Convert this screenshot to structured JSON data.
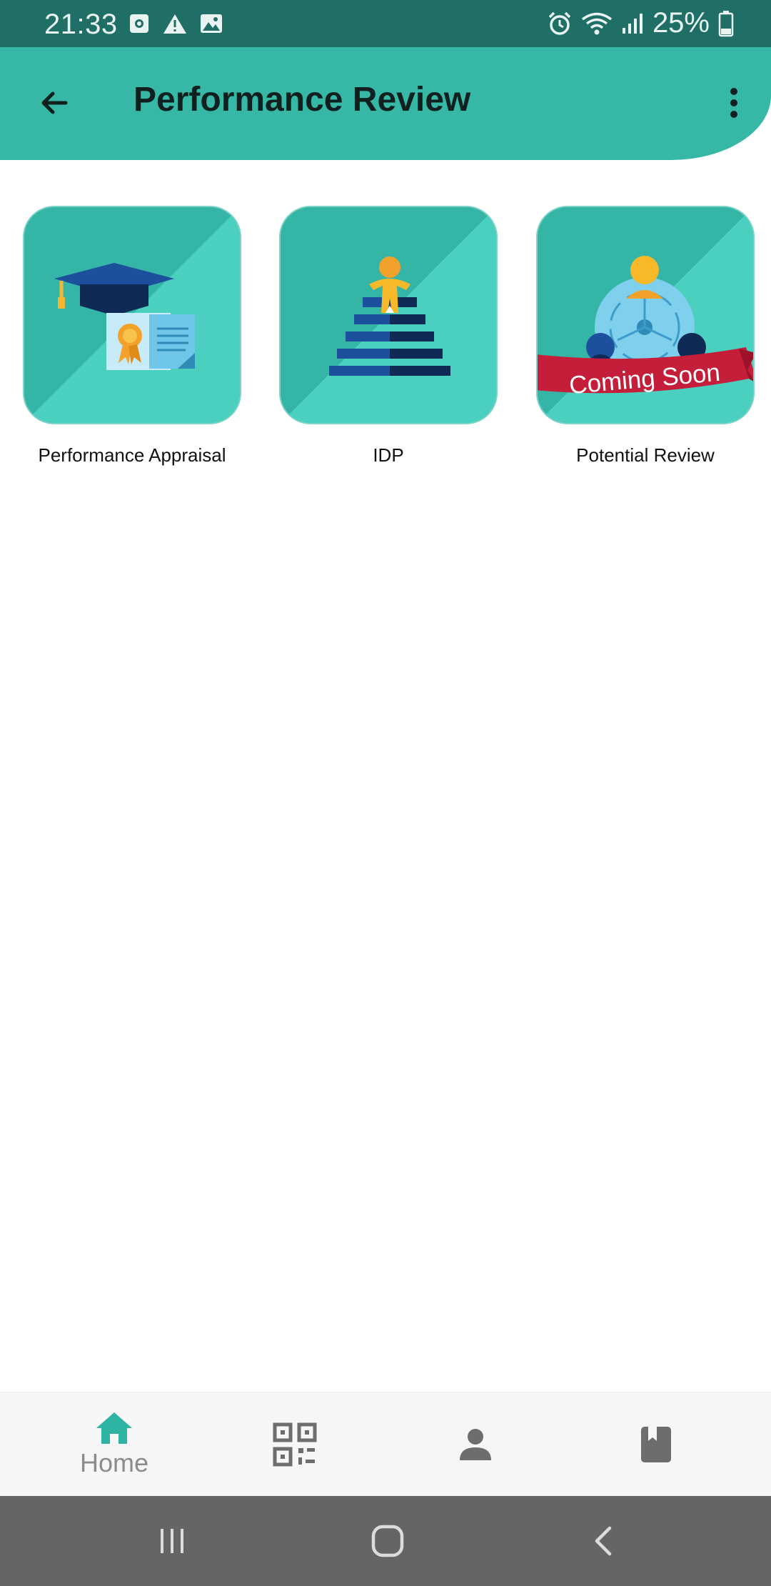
{
  "status_bar": {
    "time": "21:33",
    "battery": "25%",
    "icons": [
      "screenshot-icon",
      "warning-icon",
      "image-icon",
      "alarm-icon",
      "wifi-icon",
      "signal-icon",
      "battery-icon"
    ]
  },
  "app_bar": {
    "title": "Performance Review",
    "back_icon": "arrow-left-icon",
    "menu_icon": "more-vert-icon"
  },
  "tiles": [
    {
      "label": "Performance Appraisal",
      "icon": "graduation-certificate-icon"
    },
    {
      "label": "IDP",
      "icon": "staircase-figure-icon"
    },
    {
      "label": "Potential Review",
      "icon": "team-globe-icon",
      "ribbon": "Coming Soon"
    }
  ],
  "bottom_nav": {
    "items": [
      {
        "label": "Home",
        "icon": "home-icon",
        "active": true
      },
      {
        "label": "",
        "icon": "qr-code-icon"
      },
      {
        "label": "",
        "icon": "person-icon"
      },
      {
        "label": "",
        "icon": "bookmark-book-icon"
      }
    ]
  },
  "system_nav": {
    "icons": [
      "recent-apps-icon",
      "home-circle-icon",
      "back-chevron-icon"
    ]
  },
  "colors": {
    "status_bar": "#1f6f66",
    "app_bar": "#37b8a7",
    "tile_dark": "#34b5a6",
    "tile_light": "#4bcfbf",
    "active_nav": "#2fb3a2",
    "ribbon": "#c41e3a"
  }
}
